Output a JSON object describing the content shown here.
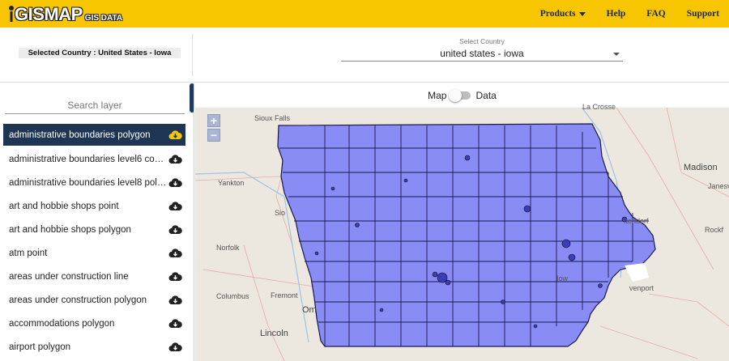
{
  "header": {
    "logo_main": "GISMAP",
    "logo_sub": "GIS DATA",
    "nav": {
      "products": "Products",
      "help": "Help",
      "faq": "FAQ",
      "support": "Support"
    }
  },
  "country_bar": {
    "selected_label": "Selected Country : United States - Iowa",
    "select_caption": "Select Country",
    "select_value": "united states - iowa"
  },
  "sidebar": {
    "search_placeholder": "Search layer",
    "layers": [
      {
        "label": "administrative boundaries polygon"
      },
      {
        "label": "administrative boundaries level6 counties polygon"
      },
      {
        "label": "administrative boundaries level8 polygon"
      },
      {
        "label": "art and hobbie shops point"
      },
      {
        "label": "art and hobbie shops polygon"
      },
      {
        "label": "atm point"
      },
      {
        "label": "areas under construction line"
      },
      {
        "label": "areas under construction polygon"
      },
      {
        "label": "accommodations polygon"
      },
      {
        "label": "airport polygon"
      }
    ]
  },
  "map": {
    "toggle_left": "Map",
    "toggle_right": "Data",
    "zoom_in": "+",
    "zoom_out": "−",
    "cities": {
      "sioux_falls": "Sioux Falls",
      "la_crosse": "La Crosse",
      "madison": "Madison",
      "yankton": "Yankton",
      "janesville": "Janesv",
      "sioux": "Sio",
      "norfolk": "Norfolk",
      "rockford": "Rockf",
      "columbus": "Columbus",
      "fremont": "Fremont",
      "omaha": "Om",
      "lincoln": "Lincoln",
      "bettendorf": "ttendorf",
      "davenport": "venport",
      "iowa_city": "Iow"
    }
  },
  "colors": {
    "header_bg": "#f7c600",
    "active_layer_bg": "#1e3554",
    "state_fill": "#8a8cf5",
    "map_bg": "#ece7df"
  }
}
